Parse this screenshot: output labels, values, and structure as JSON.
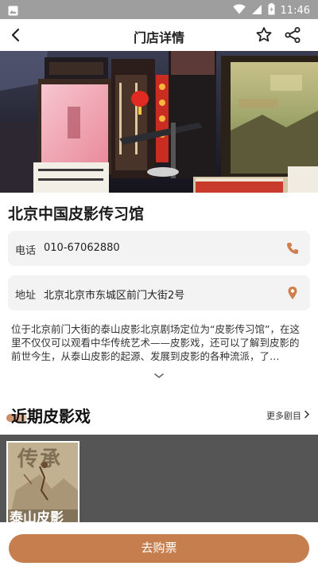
{
  "status_bar": {
    "time": "11:46"
  },
  "nav": {
    "title": "门店详情"
  },
  "store": {
    "name": "北京中国皮影传习馆",
    "phone_label": "电话",
    "phone": "010-67062880",
    "address_label": "地址",
    "address": "北京北京市东城区前门大街2号",
    "description": "位于北京前门大街的泰山皮影北京剧场定位为“皮影传习馆”，在这里不仅仅可以观看中华传统艺术——皮影戏，还可以了解到皮影的前世今生，从泰山皮影的起源、发展到皮影的各种流派，了…"
  },
  "section": {
    "title": "近期皮影戏",
    "more_label": "更多剧目"
  },
  "poster": {
    "text_top": "传承",
    "text_bottom": "泰山皮影"
  },
  "buy": {
    "label": "去购票"
  },
  "colors": {
    "accent": "#c67e4e",
    "status_bar": "#9e9e9e",
    "card_bg": "#f3f3f3"
  }
}
